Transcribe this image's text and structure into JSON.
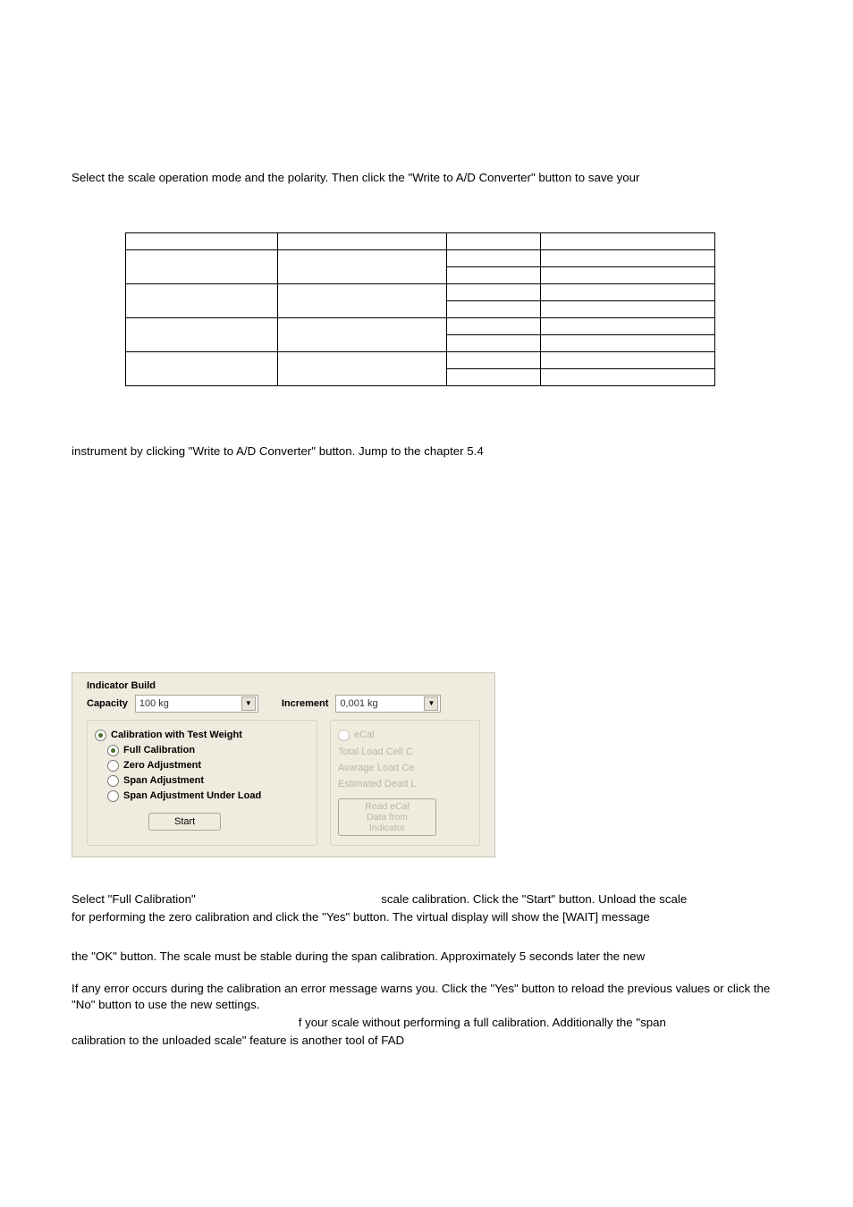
{
  "para1": "Select the scale operation mode and the polarity. Then click the \"Write to A/D Converter\" button to save your",
  "para2": "instrument by clicking \"Write to A/D Converter\" button. Jump to the chapter 5.4",
  "ui": {
    "buildLabel": "Indicator Build",
    "capacityLabel": "Capacity",
    "capacityValue": "100 kg",
    "incrementLabel": "Increment",
    "incrementValue": "0,001 kg",
    "leftGroupTitle": "Calibration with Test Weight",
    "radios": {
      "full": "Full Calibration",
      "zero": "Zero Adjustment",
      "span": "Span Adjustment",
      "spanLoad": "Span Adjustment Under Load"
    },
    "startBtn": "Start",
    "rightGroupTitle": "eCal",
    "rg1": "Total Load Cell C",
    "rg2": "Avarage Load Ce",
    "rg3": "Estimated Dead L",
    "readBtnL1": "Read eCal",
    "readBtnL2": "Data from",
    "readBtnL3": "Indicator"
  },
  "para3a": "Select \"Full Calibration\"",
  "para3b": "scale calibration. Click the \"Start\" button. Unload the scale",
  "para4": "for performing the zero calibration and click the \"Yes\" button. The virtual display will show the [WAIT] message",
  "para5": "the \"OK\" button. The scale must be stable during the span calibration. Approximately 5 seconds later the new",
  "para6": "If any error occurs during the calibration an error message warns you. Click the \"Yes\" button to reload the previous values or click the \"No\" button to use the new settings.",
  "para7a": "f your scale without performing a full calibration. Additionally the \"span",
  "para8": "calibration to the unloaded scale\" feature is another tool of FAD"
}
